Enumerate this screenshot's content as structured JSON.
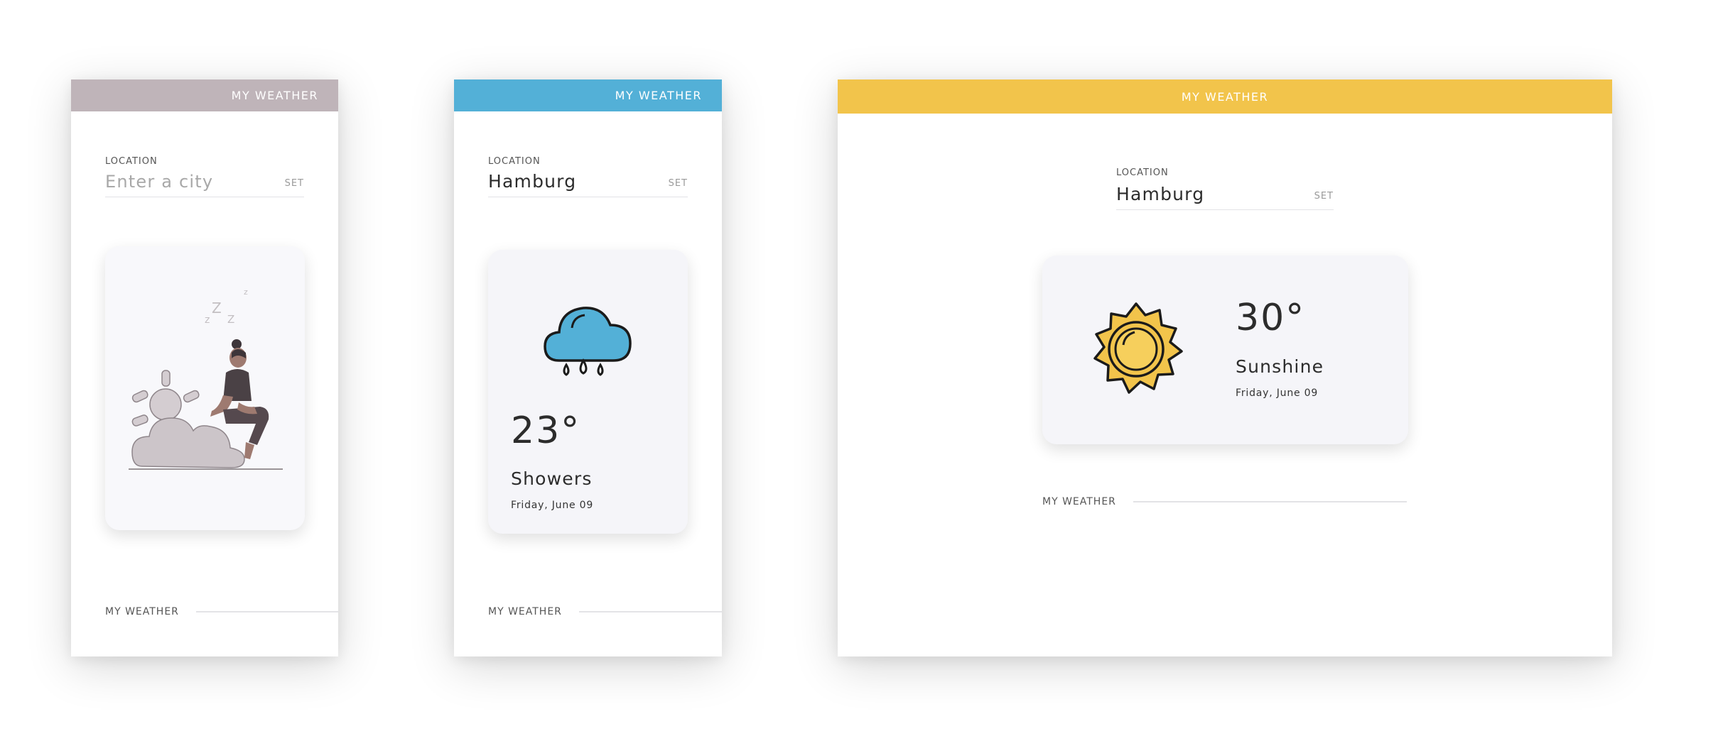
{
  "colors": {
    "mauve": "#bfb4b9",
    "blue": "#53b0d7",
    "yellow": "#f2c44b"
  },
  "screens": [
    {
      "app_title": "MY WEATHER",
      "location_label": "LOCATION",
      "city_value": "",
      "city_placeholder": "Enter a city",
      "set_label": "SET",
      "illustration": "sleeping-person-on-cloud-illustration",
      "sleep_glyphs": [
        "Z",
        "Z",
        "z",
        "z"
      ],
      "footer_label": "MY WEATHER"
    },
    {
      "app_title": "MY WEATHER",
      "location_label": "LOCATION",
      "city_value": "Hamburg",
      "set_label": "SET",
      "icon": "rain-cloud-icon",
      "temperature": "23°",
      "condition": "Showers",
      "date": "Friday, June 09",
      "footer_label": "MY WEATHER"
    },
    {
      "app_title": "MY WEATHER",
      "location_label": "LOCATION",
      "city_value": "Hamburg",
      "set_label": "SET",
      "icon": "sun-icon",
      "temperature": "30°",
      "condition": "Sunshine",
      "date": "Friday, June 09",
      "footer_label": "MY WEATHER"
    }
  ]
}
